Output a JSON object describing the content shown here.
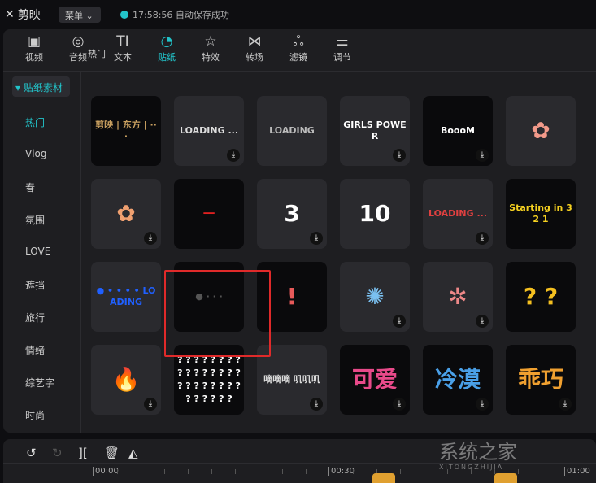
{
  "app": {
    "name": "剪映",
    "menu_label": "菜单",
    "status": "17:58:56 自动保存成功"
  },
  "tabs": [
    {
      "label": "视频",
      "icon": "video-icon",
      "glyph": "▣"
    },
    {
      "label": "音频",
      "icon": "audio-icon",
      "glyph": "◎"
    },
    {
      "label": "文本",
      "icon": "text-icon",
      "glyph": "TI"
    },
    {
      "label": "贴纸",
      "icon": "sticker-icon",
      "glyph": "◔"
    },
    {
      "label": "特效",
      "icon": "effects-icon",
      "glyph": "☆"
    },
    {
      "label": "转场",
      "icon": "transition-icon",
      "glyph": "⋈"
    },
    {
      "label": "滤镜",
      "icon": "filter-icon",
      "glyph": "ஃ"
    },
    {
      "label": "调节",
      "icon": "adjust-icon",
      "glyph": "⚌"
    }
  ],
  "active_tab": "贴纸",
  "sidebar": {
    "header": "▾ 贴纸素材",
    "items": [
      "热门",
      "Vlog",
      "春",
      "氛围",
      "LOVE",
      "遮挡",
      "旅行",
      "情绪",
      "综艺字",
      "时尚"
    ]
  },
  "section_title": "热门",
  "stickers": [
    {
      "text": "剪映 | 东方 | ···",
      "dark": true,
      "dl": false,
      "color": "#c9a060"
    },
    {
      "text": "LOADING ...",
      "dark": false,
      "dl": true,
      "color": "#ddd"
    },
    {
      "text": "LOADING",
      "dark": false,
      "dl": false,
      "color": "#bbb"
    },
    {
      "text": "GIRLS POWER",
      "dark": false,
      "dl": true,
      "color": "#fff"
    },
    {
      "text": "BoooM",
      "dark": true,
      "dl": true,
      "color": "#fff"
    },
    {
      "text": "✿",
      "dark": false,
      "dl": false,
      "color": "#f39a8a"
    },
    {
      "text": "✿",
      "dark": false,
      "dl": true,
      "color": "#f0a070"
    },
    {
      "text": "━━",
      "dark": true,
      "dl": false,
      "color": "#e02020"
    },
    {
      "text": "3",
      "dark": false,
      "dl": true,
      "color": "#fff"
    },
    {
      "text": "10",
      "dark": false,
      "dl": false,
      "color": "#fff"
    },
    {
      "text": "LOADING ...",
      "dark": false,
      "dl": true,
      "color": "#e04040"
    },
    {
      "text": "Starting in 3 2 1",
      "dark": true,
      "dl": false,
      "color": "#f5d020"
    },
    {
      "text": "● • • • • LOADING",
      "dark": false,
      "dl": false,
      "color": "#2060ff"
    },
    {
      "text": "● · · ·",
      "dark": true,
      "dl": false,
      "color": "#555"
    },
    {
      "text": "!",
      "dark": true,
      "dl": false,
      "color": "#e85a5a"
    },
    {
      "text": "✺",
      "dark": false,
      "dl": true,
      "color": "#7ac0f0"
    },
    {
      "text": "✲",
      "dark": false,
      "dl": true,
      "color": "#e88"
    },
    {
      "text": "? ?",
      "dark": true,
      "dl": false,
      "color": "#f5c020"
    },
    {
      "text": "🔥",
      "dark": false,
      "dl": true,
      "color": "#f08020"
    },
    {
      "text": "? ? ? ? ? ? ? ? ? ? ? ? ? ? ? ? ? ? ? ? ? ? ? ? ? ? ? ? ? ?",
      "dark": true,
      "dl": false,
      "color": "#fff"
    },
    {
      "text": "嘀嘀嘀 叽叽叽",
      "dark": false,
      "dl": true,
      "color": "#ddd"
    },
    {
      "text": "可爱",
      "dark": true,
      "dl": true,
      "color": "#e84a8a"
    },
    {
      "text": "冷漠",
      "dark": true,
      "dl": true,
      "color": "#4aa0e8"
    },
    {
      "text": "乖巧",
      "dark": true,
      "dl": true,
      "color": "#f0a030"
    }
  ],
  "timeline": {
    "tools": [
      {
        "name": "undo-icon",
        "glyph": "↺"
      },
      {
        "name": "redo-icon",
        "glyph": "↻"
      },
      {
        "name": "split-icon",
        "glyph": "]["
      },
      {
        "name": "delete-icon",
        "glyph": "🗑"
      },
      {
        "name": "mirror-icon",
        "glyph": "◭"
      }
    ],
    "ticks": [
      "00:00",
      "00:30",
      "01:00"
    ]
  },
  "watermark": {
    "text": "系统之家",
    "sub": "XITONGZHIJIA"
  }
}
